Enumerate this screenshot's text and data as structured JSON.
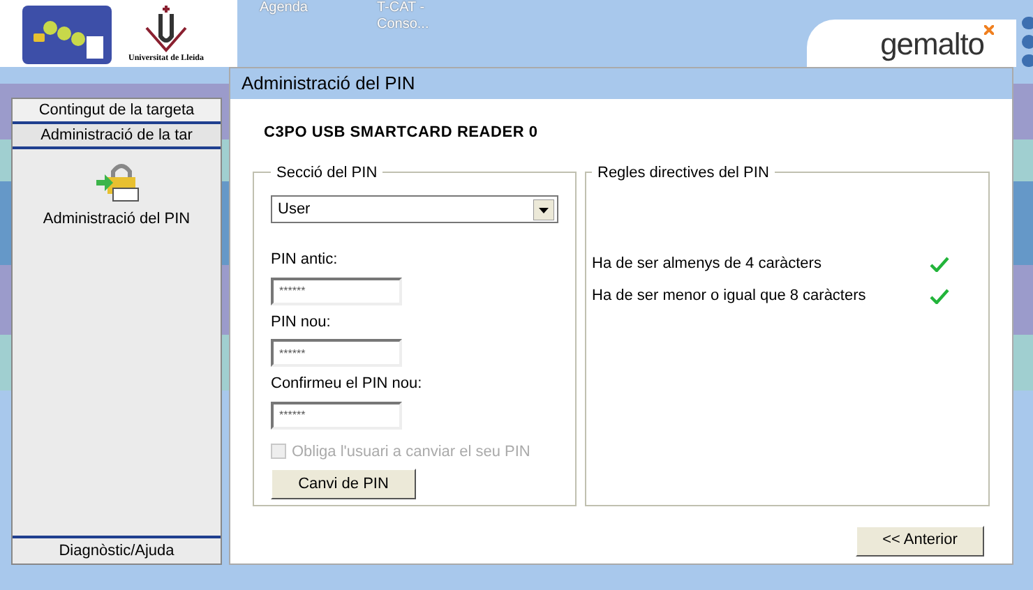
{
  "header": {
    "university": "Universitat de Lleida",
    "tabs": [
      {
        "label": "Agenda"
      },
      {
        "label": "T-CAT - Conso..."
      }
    ],
    "brand": "gemalto"
  },
  "sidebar": {
    "sections": [
      {
        "label": "Contingut de la targeta",
        "expanded": false
      },
      {
        "label": "Administració de la tar",
        "expanded": true,
        "items": [
          {
            "label": "Administració del PIN"
          }
        ]
      }
    ],
    "footer": "Diagnòstic/Ajuda"
  },
  "panel": {
    "title": "Administració del PIN",
    "reader": "C3PO USB SMARTCARD READER 0",
    "pin_section": {
      "legend": "Secció del PIN",
      "dropdown": "User",
      "fields": [
        {
          "label": "PIN antic:",
          "value": "******"
        },
        {
          "label": "PIN nou:",
          "value": "******"
        },
        {
          "label": "Confirmeu el PIN nou:",
          "value": "******"
        }
      ],
      "checkbox": {
        "label": "Obliga l'usuari a canviar el seu PIN",
        "checked": false,
        "disabled": true
      },
      "button": "Canvi de PIN"
    },
    "rules": {
      "legend": "Regles directives del PIN",
      "items": [
        {
          "text": "Ha de ser almenys de 4 caràcters",
          "met": true
        },
        {
          "text": "Ha de ser menor o igual que 8 caràcters",
          "met": true
        }
      ]
    },
    "back_button": "<< Anterior"
  }
}
